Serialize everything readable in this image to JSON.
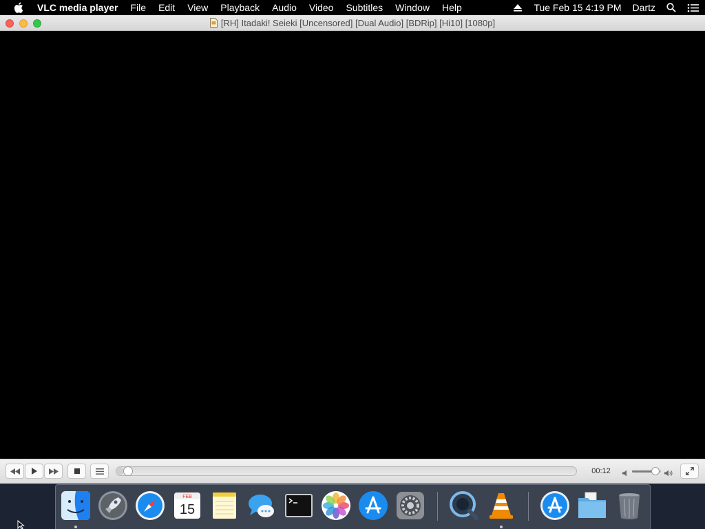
{
  "menubar": {
    "app_name": "VLC media player",
    "menus": [
      "File",
      "Edit",
      "View",
      "Playback",
      "Audio",
      "Video",
      "Subtitles",
      "Window",
      "Help"
    ],
    "clock": "Tue Feb 15  4:19 PM",
    "user": "Dartz"
  },
  "window": {
    "title": "[RH] Itadaki! Seieki [Uncensored] [Dual Audio] [BDRip] [Hi10] [1080p]"
  },
  "controller": {
    "elapsed": "00:12",
    "progress_fraction": 0.015,
    "volume_fraction": 0.8
  },
  "dock": {
    "apps": [
      "Finder",
      "Launchpad",
      "Safari",
      "Calendar",
      "Notes",
      "Messages",
      "Terminal",
      "Photos",
      "App Store",
      "System Preferences",
      "QuickTime Player",
      "VLC",
      "App Store Downloads",
      "Documents",
      "Trash"
    ],
    "calendar_month": "FEB",
    "calendar_day": "15"
  },
  "colors": {
    "close": "#fc605b",
    "minimize": "#fdbc40",
    "zoom": "#34c84a",
    "vlc_orange": "#f08a00",
    "finder_blue": "#1e7ff0"
  }
}
